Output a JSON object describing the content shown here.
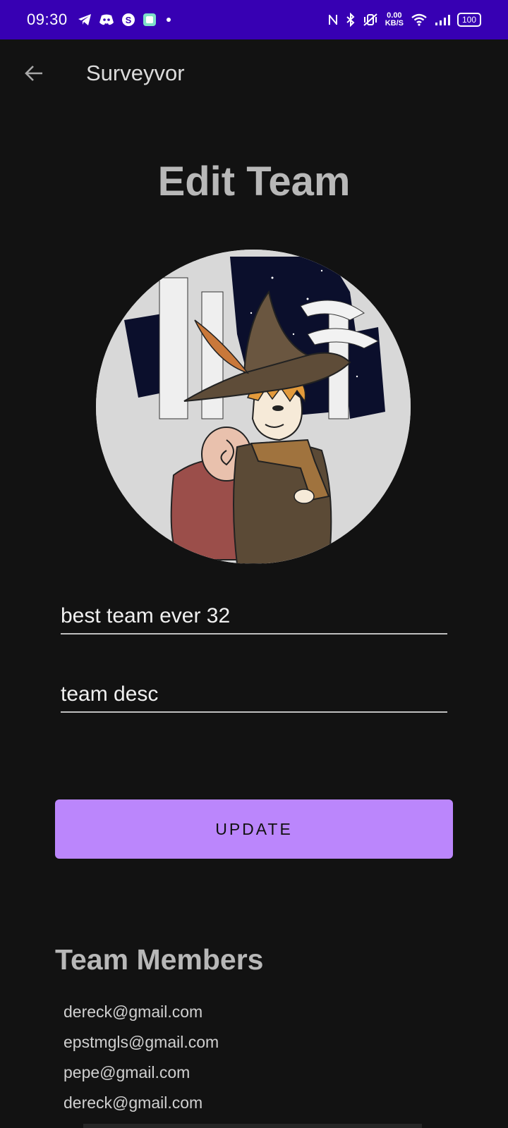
{
  "status_bar": {
    "time": "09:30",
    "left_icons": [
      "telegram-icon",
      "discord-icon",
      "skype-icon",
      "app-icon",
      "dot-icon"
    ],
    "net_speed_value": "0.00",
    "net_speed_unit": "KB/S",
    "battery": "100",
    "right_icons": [
      "nfc-icon",
      "bluetooth-icon",
      "vibrate-icon",
      "wifi-icon",
      "signal-icon",
      "battery-icon"
    ]
  },
  "app_bar": {
    "back_icon": "arrow-back-icon",
    "title": "Surveyvor"
  },
  "page": {
    "title": "Edit Team",
    "avatar_icon": "team-avatar-image"
  },
  "form": {
    "team_name_value": "best team ever 32",
    "team_desc_value": "team desc",
    "update_label": "UPDATE"
  },
  "members": {
    "title": "Team Members",
    "list": [
      "dereck@gmail.com",
      "epstmgls@gmail.com",
      "pepe@gmail.com",
      "dereck@gmail.com"
    ]
  },
  "colors": {
    "status_bar": "#3700b3",
    "background": "#121212",
    "accent": "#bb86fc"
  }
}
